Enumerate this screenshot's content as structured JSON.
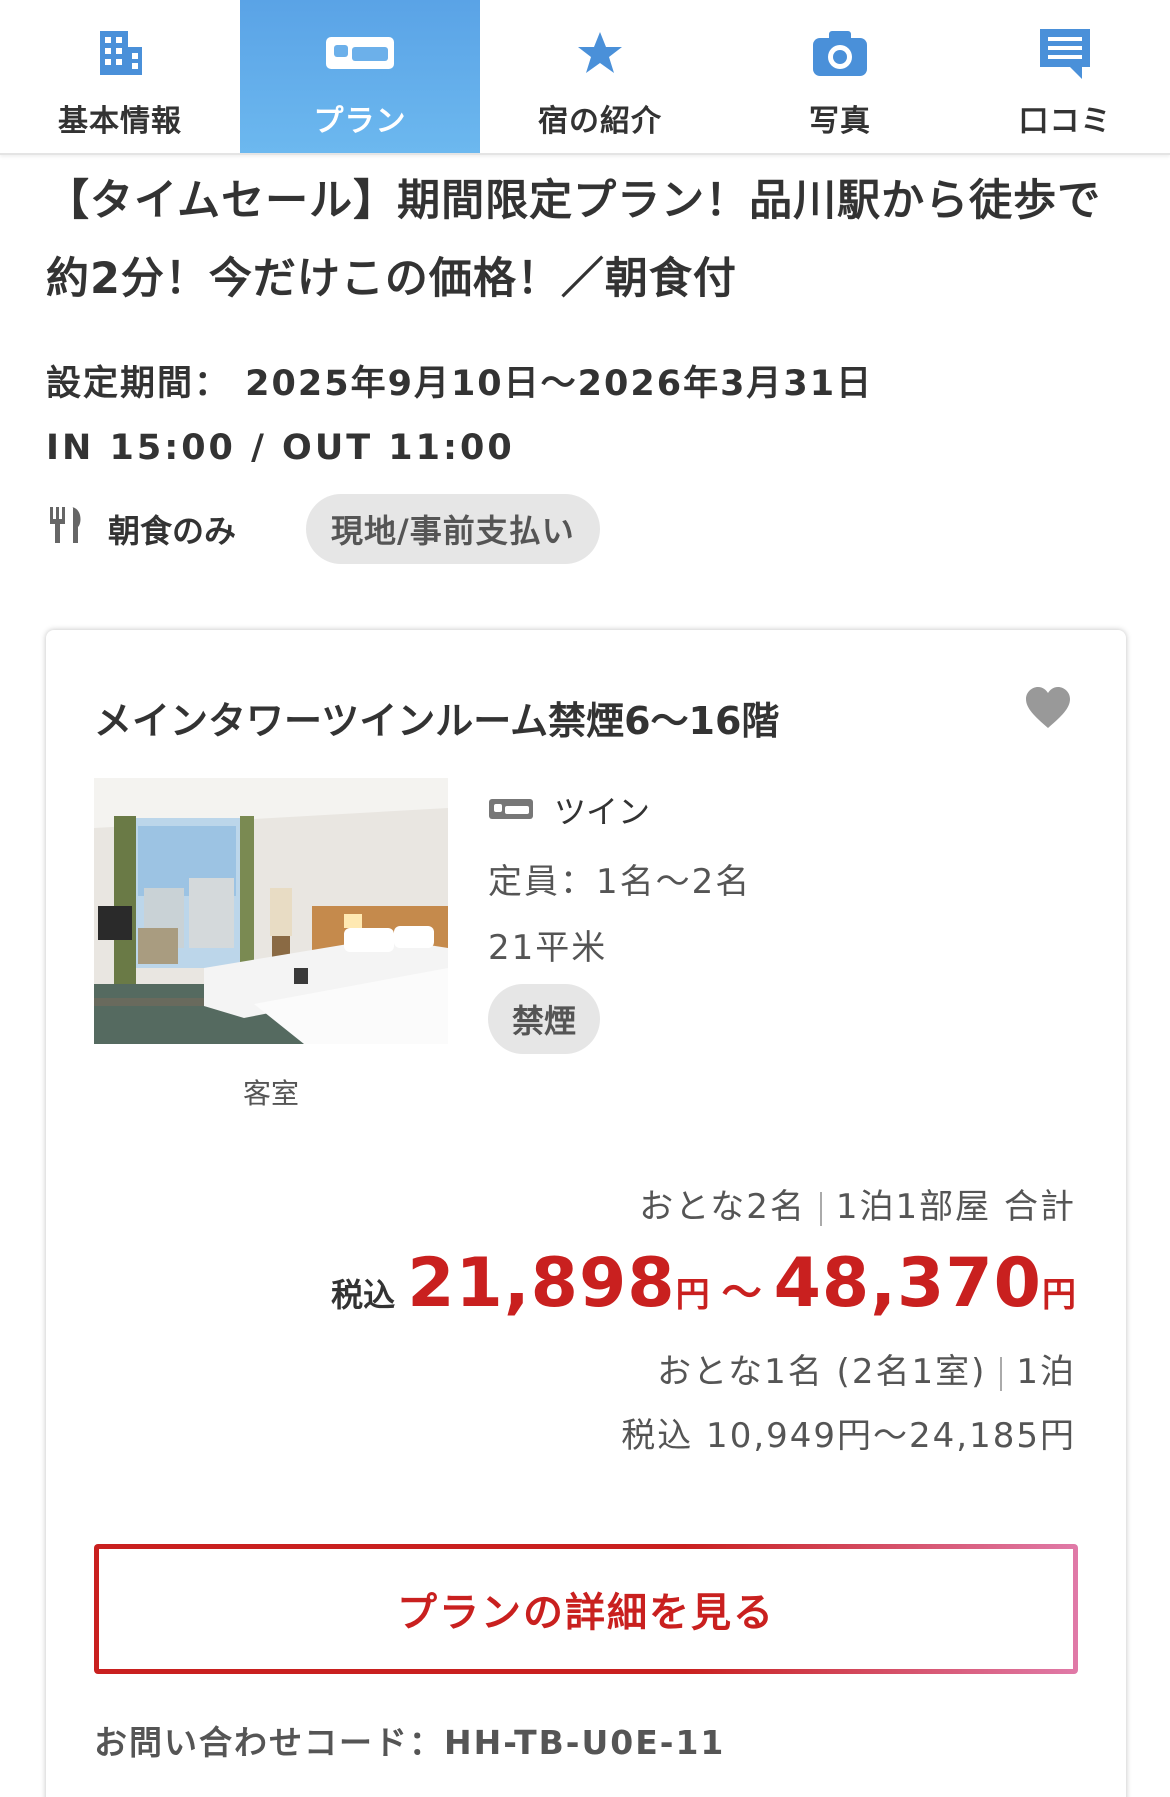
{
  "tabs": [
    {
      "label": "基本情報",
      "icon": "building-icon",
      "active": false
    },
    {
      "label": "プラン",
      "icon": "bed-icon",
      "active": true
    },
    {
      "label": "宿の紹介",
      "icon": "star-icon",
      "active": false
    },
    {
      "label": "写真",
      "icon": "camera-icon",
      "active": false
    },
    {
      "label": "口コミ",
      "icon": "comment-icon",
      "active": false
    }
  ],
  "plan": {
    "title": "【タイムセール】期間限定プラン！品川駅から徒歩で約2分！今だけこの価格！／朝食付",
    "period": "設定期間： 2025年9月10日〜2026年3月31日",
    "checkin_out": "IN 15:00 / OUT 11:00",
    "meal": "朝食のみ",
    "payment": "現地/事前支払い"
  },
  "room": {
    "name": "メインタワーツインルーム禁煙6〜16階",
    "photo_caption": "客室",
    "bed_type": "ツイン",
    "capacity": "定員：1名〜2名",
    "area": "21平米",
    "smoking": "禁煙",
    "occupancy_summary": "おとな2名",
    "stay_summary": "1泊1部屋 合計",
    "tax_label": "税込",
    "price_min": "21,898",
    "price_max": "48,370",
    "yen": "円",
    "tilde": "～",
    "per_person_label": "おとな1名 (2名1室)",
    "per_person_nights": "1泊",
    "per_person_price": "税込 10,949円〜24,185円",
    "detail_button": "プランの詳細を見る",
    "inquiry_code": "お問い合わせコード：HH-TB-U0E-11"
  },
  "colors": {
    "accent_blue": "#5aa3e6",
    "price_red": "#c9201f",
    "badge_gray": "#e6e6e6"
  }
}
